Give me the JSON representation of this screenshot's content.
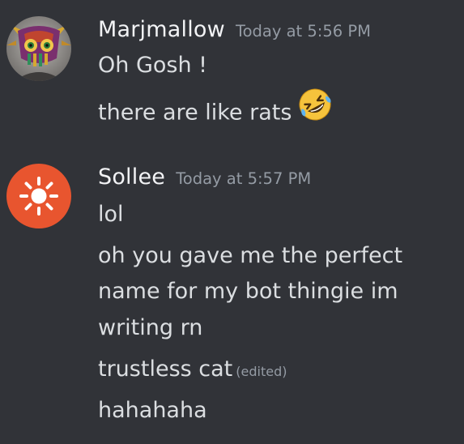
{
  "colors": {
    "background": "#313338",
    "username": "#f2f3f5",
    "message_text": "#dbdee1",
    "muted": "#949ba4",
    "sollee_avatar": "#e8552f"
  },
  "messages": [
    {
      "author": "Marjmallow",
      "timestamp": "Today at 5:56 PM",
      "avatar_icon": "mask-avatar-icon",
      "lines": [
        "Oh Gosh !",
        "there are like rats"
      ],
      "emoji": "rolling-on-floor-laughing-emoji"
    },
    {
      "author": "Sollee",
      "timestamp": "Today at 5:57 PM",
      "avatar_icon": "sun-avatar-icon",
      "lines": [
        "lol",
        "oh you gave me the perfect",
        "name for my bot thingie im",
        "writing rn",
        "trustless cat",
        "hahahaha"
      ],
      "edited_label": "(edited)"
    }
  ]
}
